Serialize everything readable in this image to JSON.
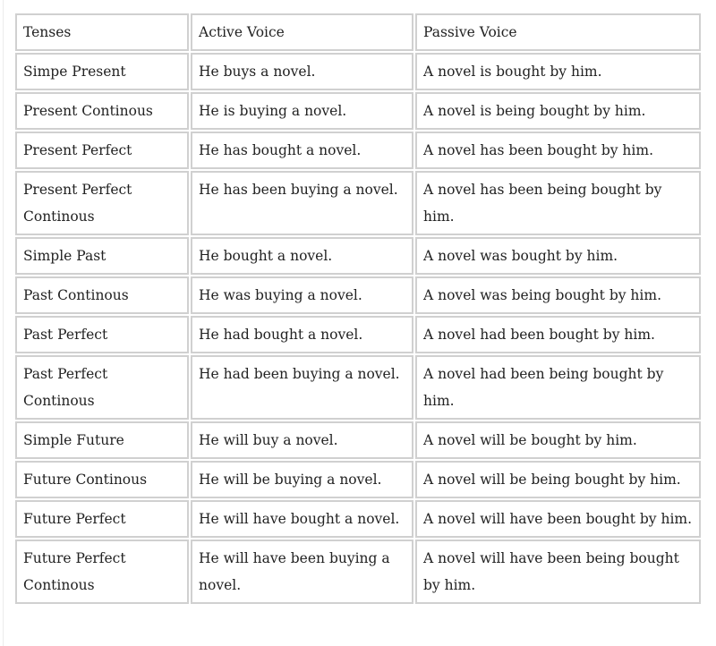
{
  "table": {
    "header": [
      "Tenses",
      "Active Voice",
      "Passive Voice"
    ],
    "rows": [
      [
        "Simpe Present",
        "He buys a novel.",
        "A novel is bought by him."
      ],
      [
        "Present Continous",
        "He is buying a novel.",
        "A novel is being bought by him."
      ],
      [
        "Present Perfect",
        "He has bought a novel.",
        "A novel has been bought by him."
      ],
      [
        "Present Perfect Continous",
        "He has been buying a novel.",
        "A novel has been being bought by him."
      ],
      [
        "Simple Past",
        "He bought a novel.",
        "A novel was bought by him."
      ],
      [
        "Past Continous",
        "He was buying a novel.",
        "A novel was being bought by him."
      ],
      [
        "Past Perfect",
        "He had bought a novel.",
        "A novel had been bought by him."
      ],
      [
        "Past Perfect Continous",
        "He had been buying a novel.",
        "A novel had been being bought by him."
      ],
      [
        "Simple Future",
        "He will buy a novel.",
        "A novel will be bought by him."
      ],
      [
        "Future Continous",
        "He will be buying a novel.",
        "A novel will be being bought by him."
      ],
      [
        "Future Perfect",
        "He will have bought a novel.",
        "A novel will have been bought by him."
      ],
      [
        "Future Perfect Continous",
        "He will have been buying a novel.",
        "A novel will have been being bought by him."
      ]
    ]
  }
}
